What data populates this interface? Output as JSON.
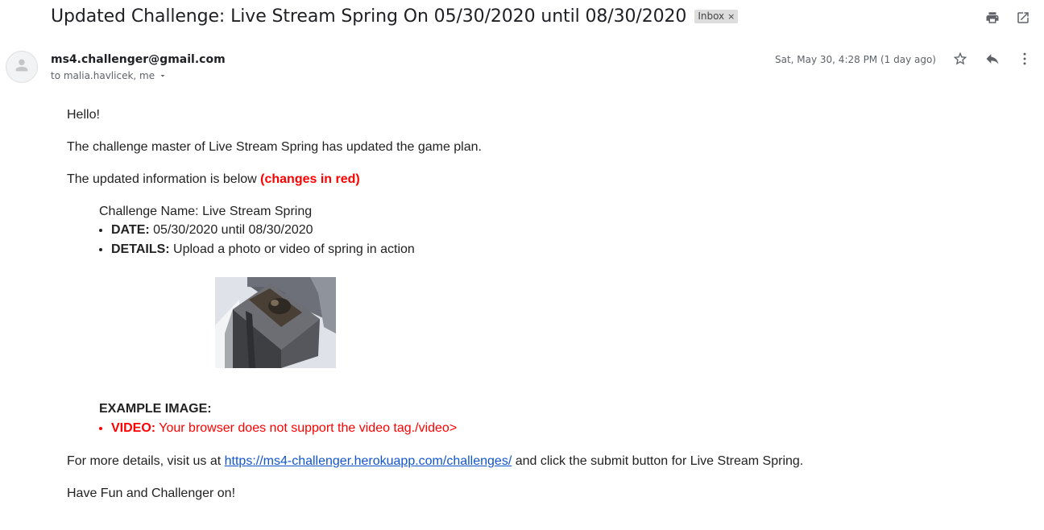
{
  "email": {
    "subject": "Updated Challenge: Live Stream Spring On 05/30/2020 until 08/30/2020",
    "label": "Inbox",
    "label_remove": "×",
    "sender": "ms4.challenger@gmail.com",
    "recipients": "to malia.havlicek, me",
    "date": "Sat, May 30, 4:28 PM (1 day ago)"
  },
  "icons": {
    "print": "print-icon",
    "open_new_window": "open-in-new-window-icon",
    "avatar": "person-icon",
    "caret": "chevron-down-icon",
    "star": "star-icon",
    "reply": "reply-icon",
    "more": "more-vertical-icon"
  },
  "body": {
    "greeting": "Hello!",
    "intro": "The challenge master of Live Stream Spring has updated the game plan.",
    "updated_prefix": "The updated information is below ",
    "updated_changes": "(changes in red)",
    "challenge_name": "Challenge Name: Live Stream Spring",
    "date_label": "DATE:",
    "date_value": " 05/30/2020 until 08/30/2020",
    "details_label": "DETAILS:",
    "details_value": " Upload a photo or video of spring in action",
    "example_title": "EXAMPLE IMAGE:",
    "video_label": "VIDEO:",
    "video_value": " Your browser does not support the video tag./video>",
    "more_prefix": "For more details, visit us at ",
    "more_link": "https://ms4-challenger.herokuapp.com/challenges/",
    "more_suffix": " and click the submit button for Live Stream Spring.",
    "closing": "Have Fun and Challenger on!"
  },
  "colors": {
    "accent_red": "#ff0000",
    "link": "#1155cc",
    "label_bg": "#dddddd"
  }
}
